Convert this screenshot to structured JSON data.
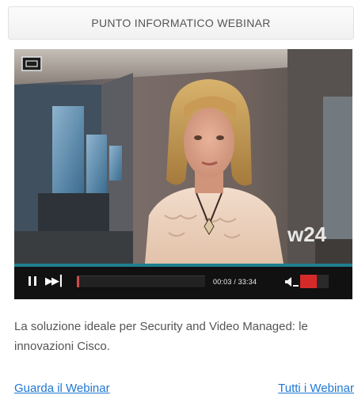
{
  "header": {
    "title": "PUNTO INFORMATICO WEBINAR"
  },
  "video": {
    "watermark": "w24",
    "time_display": "00:03 / 33:34",
    "progress_fraction": 0.02,
    "volume_fraction": 0.58,
    "accent_color": "#1f7f8f",
    "progress_color": "#d04a4a",
    "volume_color": "#d52a2a",
    "icons": {
      "screen": "screen-icon",
      "pause": "pause-icon",
      "next": "next-icon",
      "volume": "volume-icon"
    }
  },
  "description": "La soluzione ideale per Security and Video Managed: le innovazioni Cisco.",
  "links": {
    "watch": "Guarda il Webinar",
    "all": "Tutti i Webinar"
  },
  "colors": {
    "link": "#1f78d4",
    "text": "#555555",
    "header_border": "#e2e2e2"
  }
}
